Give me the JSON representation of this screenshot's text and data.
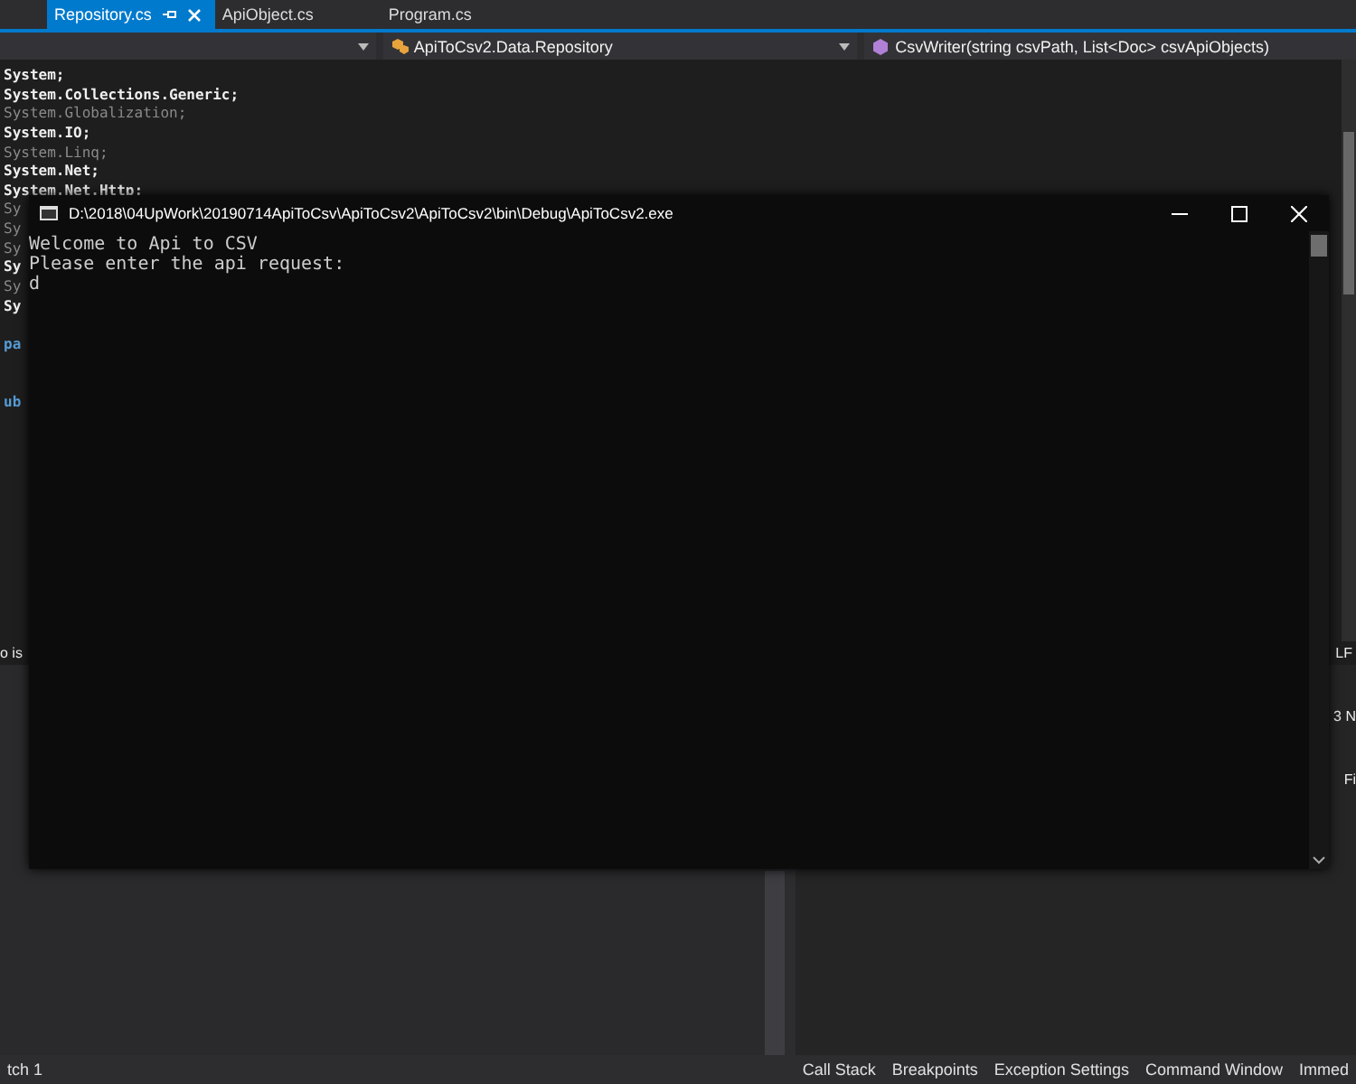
{
  "editor_tabs": [
    {
      "label": "Repository.cs",
      "selected": true,
      "pinned": true,
      "closable": true
    },
    {
      "label": "ApiObject.cs",
      "selected": false,
      "pinned": false,
      "closable": false
    },
    {
      "label": "Program.cs",
      "selected": false,
      "pinned": false,
      "closable": false
    }
  ],
  "navigation_bar": {
    "type_dropdown": "ApiToCsv2.Data.Repository",
    "member_dropdown": "CsvWriter(string csvPath, List<Doc> csvApiObjects)"
  },
  "code_lines": [
    {
      "kind": "code",
      "text": "System;",
      "dim": false
    },
    {
      "kind": "code",
      "text": "System.Collections.Generic;",
      "dim": false
    },
    {
      "kind": "code",
      "text": "System.Globalization;",
      "dim": true
    },
    {
      "kind": "code",
      "text": "System.IO;",
      "dim": false
    },
    {
      "kind": "code",
      "text": "System.Linq;",
      "dim": true
    },
    {
      "kind": "code",
      "text": "System.Net;",
      "dim": false
    },
    {
      "kind": "code",
      "text": "System.Net.Http;",
      "dim": false
    },
    {
      "kind": "code",
      "text": "Sy",
      "dim": true
    },
    {
      "kind": "code",
      "text": "Sy",
      "dim": true
    },
    {
      "kind": "code",
      "text": "Sy",
      "dim": true
    },
    {
      "kind": "code",
      "text": "Sy",
      "dim": false
    },
    {
      "kind": "code",
      "text": "Sy",
      "dim": true
    },
    {
      "kind": "code",
      "text": "Sy",
      "dim": false
    },
    {
      "kind": "blank"
    },
    {
      "kind": "keyword",
      "text": "pa"
    },
    {
      "kind": "blank"
    },
    {
      "kind": "blank"
    },
    {
      "kind": "keyword",
      "text": "ub"
    }
  ],
  "status_left": "o is",
  "status_right": "LF",
  "right_panel_texts": [
    "3 N",
    "Fi"
  ],
  "bottom_tabs_left": [
    "tch 1"
  ],
  "bottom_tabs_right": [
    "Call Stack",
    "Breakpoints",
    "Exception Settings",
    "Command Window",
    "Immed"
  ],
  "console": {
    "title": "D:\\2018\\04UpWork\\20190714ApiToCsv\\ApiToCsv2\\ApiToCsv2\\bin\\Debug\\ApiToCsv2.exe",
    "lines": [
      "Welcome to Api to CSV",
      "Please enter the api request:",
      "d"
    ]
  }
}
